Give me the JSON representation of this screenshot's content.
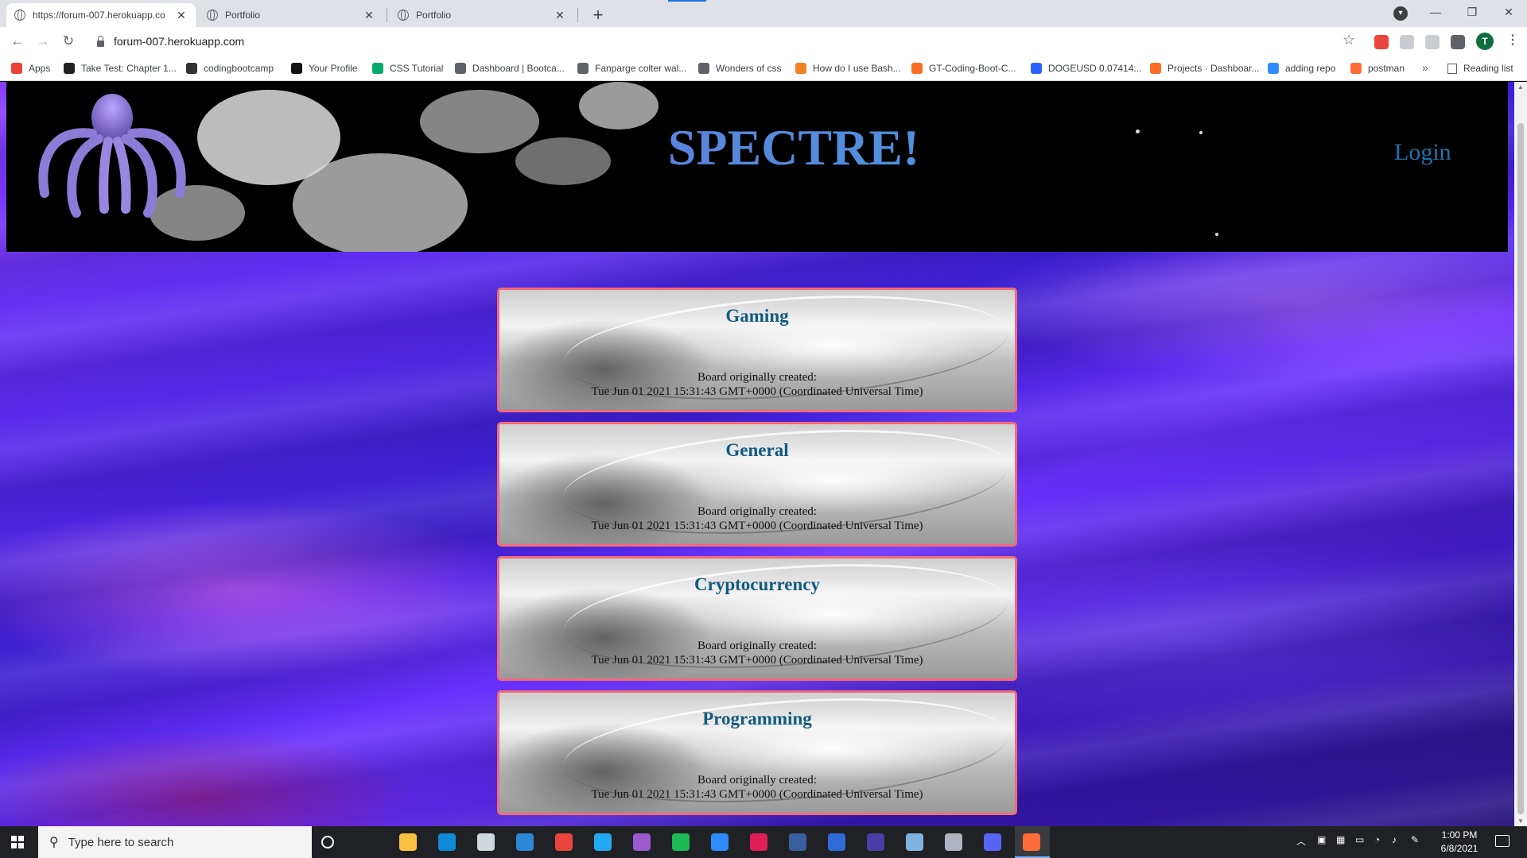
{
  "browser": {
    "tabs": [
      {
        "title": "https://forum-007.herokuapp.co",
        "active": true
      },
      {
        "title": "Portfolio",
        "active": false
      },
      {
        "title": "Portfolio",
        "active": false
      }
    ],
    "new_tab": "+",
    "url": "forum-007.herokuapp.com",
    "profile_initial": "T",
    "bookmarks": [
      {
        "label": "Apps",
        "icon": "apps-grid-icon",
        "color": "#ea4335"
      },
      {
        "label": "Take Test: Chapter 1...",
        "icon": "bb-icon",
        "color": "#222222"
      },
      {
        "label": "codingbootcamp",
        "icon": "book-icon",
        "color": "#333333"
      },
      {
        "label": "Your Profile",
        "icon": "github-icon",
        "color": "#111111"
      },
      {
        "label": "CSS Tutorial",
        "icon": "w3schools-icon",
        "color": "#04aa6d"
      },
      {
        "label": "Dashboard | Bootca...",
        "icon": "globe-icon",
        "color": "#5f6368"
      },
      {
        "label": "Fanparge colter wal...",
        "icon": "globe-icon",
        "color": "#5f6368"
      },
      {
        "label": "Wonders of css",
        "icon": "globe-icon",
        "color": "#5f6368"
      },
      {
        "label": "How do I use Bash...",
        "icon": "stackoverflow-icon",
        "color": "#f48024"
      },
      {
        "label": "GT-Coding-Boot-C...",
        "icon": "gitlab-icon",
        "color": "#fc6d26"
      },
      {
        "label": "DOGEUSD 0.07414...",
        "icon": "tradingview-icon",
        "color": "#2962ff"
      },
      {
        "label": "Projects · Dashboar...",
        "icon": "gitlab-icon",
        "color": "#fc6d26"
      },
      {
        "label": "adding repo",
        "icon": "zoom-icon",
        "color": "#2d8cff"
      },
      {
        "label": "postman",
        "icon": "postman-icon",
        "color": "#ff6c37"
      }
    ],
    "bookmarks_more": "»",
    "reading_list": "Reading list"
  },
  "site": {
    "title": "SPECTRE!",
    "login": "Login",
    "created_label": "Board originally created:",
    "boards": [
      {
        "name": "Gaming",
        "created": "Tue Jun 01 2021 15:31:43 GMT+0000 (Coordinated Universal Time)"
      },
      {
        "name": "General",
        "created": "Tue Jun 01 2021 15:31:43 GMT+0000 (Coordinated Universal Time)"
      },
      {
        "name": "Cryptocurrency",
        "created": "Tue Jun 01 2021 15:31:43 GMT+0000 (Coordinated Universal Time)"
      },
      {
        "name": "Programming",
        "created": "Tue Jun 01 2021 15:31:43 GMT+0000 (Coordinated Universal Time)"
      }
    ]
  },
  "taskbar": {
    "search_placeholder": "Type here to search",
    "time": "1:00 PM",
    "date": "6/8/2021",
    "apps": [
      {
        "name": "cortana-icon",
        "color": "#202124"
      },
      {
        "name": "task-view-icon",
        "color": "#202124"
      },
      {
        "name": "file-explorer-icon",
        "color": "#f8c140"
      },
      {
        "name": "edge-icon",
        "color": "#0f8ad8"
      },
      {
        "name": "store-icon",
        "color": "#cfd8dc"
      },
      {
        "name": "mail-icon",
        "color": "#2b88d8"
      },
      {
        "name": "chrome-icon",
        "color": "#e8453c"
      },
      {
        "name": "vscode-icon",
        "color": "#23a9f2"
      },
      {
        "name": "git-kraken-icon",
        "color": "#9b59d0"
      },
      {
        "name": "spotify-icon",
        "color": "#1db954"
      },
      {
        "name": "zoom-icon",
        "color": "#2d8cff"
      },
      {
        "name": "slack-icon",
        "color": "#e01e5a"
      },
      {
        "name": "powershell-icon",
        "color": "#3a5f9e"
      },
      {
        "name": "insomnia-icon",
        "color": "#2f6bd8"
      },
      {
        "name": "eclipse-icon",
        "color": "#4b3da8"
      },
      {
        "name": "notes-icon",
        "color": "#7fb4e0"
      },
      {
        "name": "photos-icon",
        "color": "#b0b4c0"
      },
      {
        "name": "discord-icon",
        "color": "#5865f2"
      },
      {
        "name": "postman-icon",
        "color": "#ff6c37"
      }
    ]
  }
}
